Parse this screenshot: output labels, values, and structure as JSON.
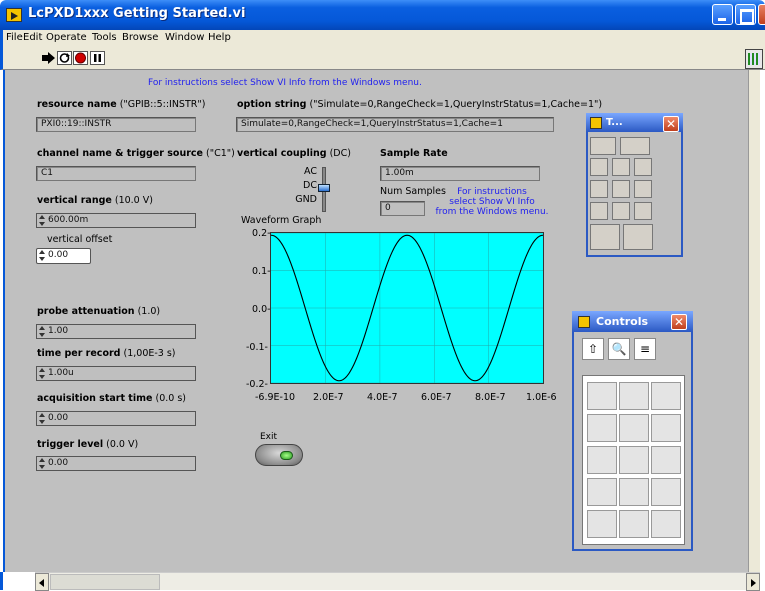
{
  "window": {
    "title": "LcPXD1xxx Getting Started.vi"
  },
  "menu": [
    "File",
    "Edit",
    "Operate",
    "Tools",
    "Browse",
    "Window",
    "Help"
  ],
  "toolbar": {
    "buttons": [
      "run-arrow-icon",
      "run-continuously-icon",
      "abort-icon",
      "pause-icon"
    ]
  },
  "panel": {
    "instructions_top": "For instructions select Show VI Info from the Windows menu.",
    "resource_name": {
      "label": "resource name",
      "default": "(\"GPIB::5::INSTR\")",
      "value": "PXI0::19::INSTR"
    },
    "option_string": {
      "label": "option string",
      "default": "(\"Simulate=0,RangeCheck=1,QueryInstrStatus=1,Cache=1\")",
      "value": "Simulate=0,RangeCheck=1,QueryInstrStatus=1,Cache=1"
    },
    "channel": {
      "label": "channel name & trigger source",
      "default": "(\"C1\")",
      "value": "C1"
    },
    "coupling": {
      "label": "vertical coupling",
      "default": "(DC)",
      "options": [
        "AC",
        "DC",
        "GND"
      ],
      "selected": "DC"
    },
    "sample_rate": {
      "label": "Sample Rate",
      "value": "1.00m"
    },
    "num_samples": {
      "label": "Num Samples",
      "value": "0"
    },
    "instructions_side": [
      "For instructions",
      "select Show VI Info",
      "from the Windows menu."
    ],
    "vertical_range": {
      "label": "vertical range",
      "default": "(10.0 V)",
      "value": "600.00m"
    },
    "vertical_offset": {
      "label": "vertical offset",
      "value": "0.00"
    },
    "probe_attenuation": {
      "label": "probe attenuation",
      "default": "(1.0)",
      "value": "1.00"
    },
    "time_per_record": {
      "label": "time per record",
      "default": "(1,00E-3 s)",
      "value": "1.00u"
    },
    "acq_start": {
      "label": "acquisition start time",
      "default": "(0.0 s)",
      "value": "0.00"
    },
    "trigger_level": {
      "label": "trigger level",
      "default": "(0.0 V)",
      "value": "0.00"
    },
    "exit": {
      "label": "Exit"
    }
  },
  "graph": {
    "title": "Waveform Graph",
    "plot_bg": "#00ffff",
    "y_ticks": [
      "0.2-",
      "0.1-",
      "0.0-",
      "-0.1-",
      "-0.2-"
    ],
    "x_ticks": [
      "-6.9E-10",
      "2.0E-7",
      "4.0E-7",
      "6.0E-7",
      "8.0E-7",
      "1.0E-6"
    ]
  },
  "chart_data": {
    "type": "line",
    "title": "Waveform Graph",
    "xlim": [
      -6.9e-10,
      1e-06
    ],
    "ylim": [
      -0.2,
      0.2
    ],
    "series": [
      {
        "amplitude": 0.2,
        "frequency_hz": 2000000,
        "phase_deg": 90
      }
    ]
  },
  "palettes": {
    "tools": {
      "title": "T..."
    },
    "controls": {
      "title": "Controls",
      "nav": [
        "up-arrow-icon",
        "search-icon",
        "options-icon"
      ]
    }
  },
  "colors": {
    "panel": "#c0c0c0",
    "titlebar": "#0558d8",
    "plot": "#00ffff",
    "trace": "#000000",
    "instruction_text": "#2222ee"
  }
}
